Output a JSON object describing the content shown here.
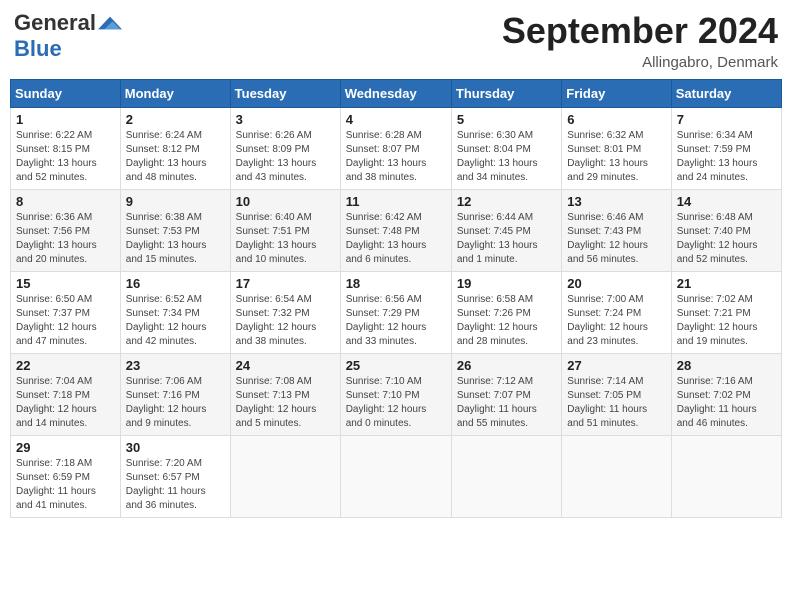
{
  "logo": {
    "general": "General",
    "blue": "Blue"
  },
  "title": "September 2024",
  "location": "Allingabro, Denmark",
  "days_of_week": [
    "Sunday",
    "Monday",
    "Tuesday",
    "Wednesday",
    "Thursday",
    "Friday",
    "Saturday"
  ],
  "weeks": [
    [
      {
        "num": "1",
        "info": "Sunrise: 6:22 AM\nSunset: 8:15 PM\nDaylight: 13 hours\nand 52 minutes."
      },
      {
        "num": "2",
        "info": "Sunrise: 6:24 AM\nSunset: 8:12 PM\nDaylight: 13 hours\nand 48 minutes."
      },
      {
        "num": "3",
        "info": "Sunrise: 6:26 AM\nSunset: 8:09 PM\nDaylight: 13 hours\nand 43 minutes."
      },
      {
        "num": "4",
        "info": "Sunrise: 6:28 AM\nSunset: 8:07 PM\nDaylight: 13 hours\nand 38 minutes."
      },
      {
        "num": "5",
        "info": "Sunrise: 6:30 AM\nSunset: 8:04 PM\nDaylight: 13 hours\nand 34 minutes."
      },
      {
        "num": "6",
        "info": "Sunrise: 6:32 AM\nSunset: 8:01 PM\nDaylight: 13 hours\nand 29 minutes."
      },
      {
        "num": "7",
        "info": "Sunrise: 6:34 AM\nSunset: 7:59 PM\nDaylight: 13 hours\nand 24 minutes."
      }
    ],
    [
      {
        "num": "8",
        "info": "Sunrise: 6:36 AM\nSunset: 7:56 PM\nDaylight: 13 hours\nand 20 minutes."
      },
      {
        "num": "9",
        "info": "Sunrise: 6:38 AM\nSunset: 7:53 PM\nDaylight: 13 hours\nand 15 minutes."
      },
      {
        "num": "10",
        "info": "Sunrise: 6:40 AM\nSunset: 7:51 PM\nDaylight: 13 hours\nand 10 minutes."
      },
      {
        "num": "11",
        "info": "Sunrise: 6:42 AM\nSunset: 7:48 PM\nDaylight: 13 hours\nand 6 minutes."
      },
      {
        "num": "12",
        "info": "Sunrise: 6:44 AM\nSunset: 7:45 PM\nDaylight: 13 hours\nand 1 minute."
      },
      {
        "num": "13",
        "info": "Sunrise: 6:46 AM\nSunset: 7:43 PM\nDaylight: 12 hours\nand 56 minutes."
      },
      {
        "num": "14",
        "info": "Sunrise: 6:48 AM\nSunset: 7:40 PM\nDaylight: 12 hours\nand 52 minutes."
      }
    ],
    [
      {
        "num": "15",
        "info": "Sunrise: 6:50 AM\nSunset: 7:37 PM\nDaylight: 12 hours\nand 47 minutes."
      },
      {
        "num": "16",
        "info": "Sunrise: 6:52 AM\nSunset: 7:34 PM\nDaylight: 12 hours\nand 42 minutes."
      },
      {
        "num": "17",
        "info": "Sunrise: 6:54 AM\nSunset: 7:32 PM\nDaylight: 12 hours\nand 38 minutes."
      },
      {
        "num": "18",
        "info": "Sunrise: 6:56 AM\nSunset: 7:29 PM\nDaylight: 12 hours\nand 33 minutes."
      },
      {
        "num": "19",
        "info": "Sunrise: 6:58 AM\nSunset: 7:26 PM\nDaylight: 12 hours\nand 28 minutes."
      },
      {
        "num": "20",
        "info": "Sunrise: 7:00 AM\nSunset: 7:24 PM\nDaylight: 12 hours\nand 23 minutes."
      },
      {
        "num": "21",
        "info": "Sunrise: 7:02 AM\nSunset: 7:21 PM\nDaylight: 12 hours\nand 19 minutes."
      }
    ],
    [
      {
        "num": "22",
        "info": "Sunrise: 7:04 AM\nSunset: 7:18 PM\nDaylight: 12 hours\nand 14 minutes."
      },
      {
        "num": "23",
        "info": "Sunrise: 7:06 AM\nSunset: 7:16 PM\nDaylight: 12 hours\nand 9 minutes."
      },
      {
        "num": "24",
        "info": "Sunrise: 7:08 AM\nSunset: 7:13 PM\nDaylight: 12 hours\nand 5 minutes."
      },
      {
        "num": "25",
        "info": "Sunrise: 7:10 AM\nSunset: 7:10 PM\nDaylight: 12 hours\nand 0 minutes."
      },
      {
        "num": "26",
        "info": "Sunrise: 7:12 AM\nSunset: 7:07 PM\nDaylight: 11 hours\nand 55 minutes."
      },
      {
        "num": "27",
        "info": "Sunrise: 7:14 AM\nSunset: 7:05 PM\nDaylight: 11 hours\nand 51 minutes."
      },
      {
        "num": "28",
        "info": "Sunrise: 7:16 AM\nSunset: 7:02 PM\nDaylight: 11 hours\nand 46 minutes."
      }
    ],
    [
      {
        "num": "29",
        "info": "Sunrise: 7:18 AM\nSunset: 6:59 PM\nDaylight: 11 hours\nand 41 minutes."
      },
      {
        "num": "30",
        "info": "Sunrise: 7:20 AM\nSunset: 6:57 PM\nDaylight: 11 hours\nand 36 minutes."
      },
      {
        "num": "",
        "info": ""
      },
      {
        "num": "",
        "info": ""
      },
      {
        "num": "",
        "info": ""
      },
      {
        "num": "",
        "info": ""
      },
      {
        "num": "",
        "info": ""
      }
    ]
  ]
}
